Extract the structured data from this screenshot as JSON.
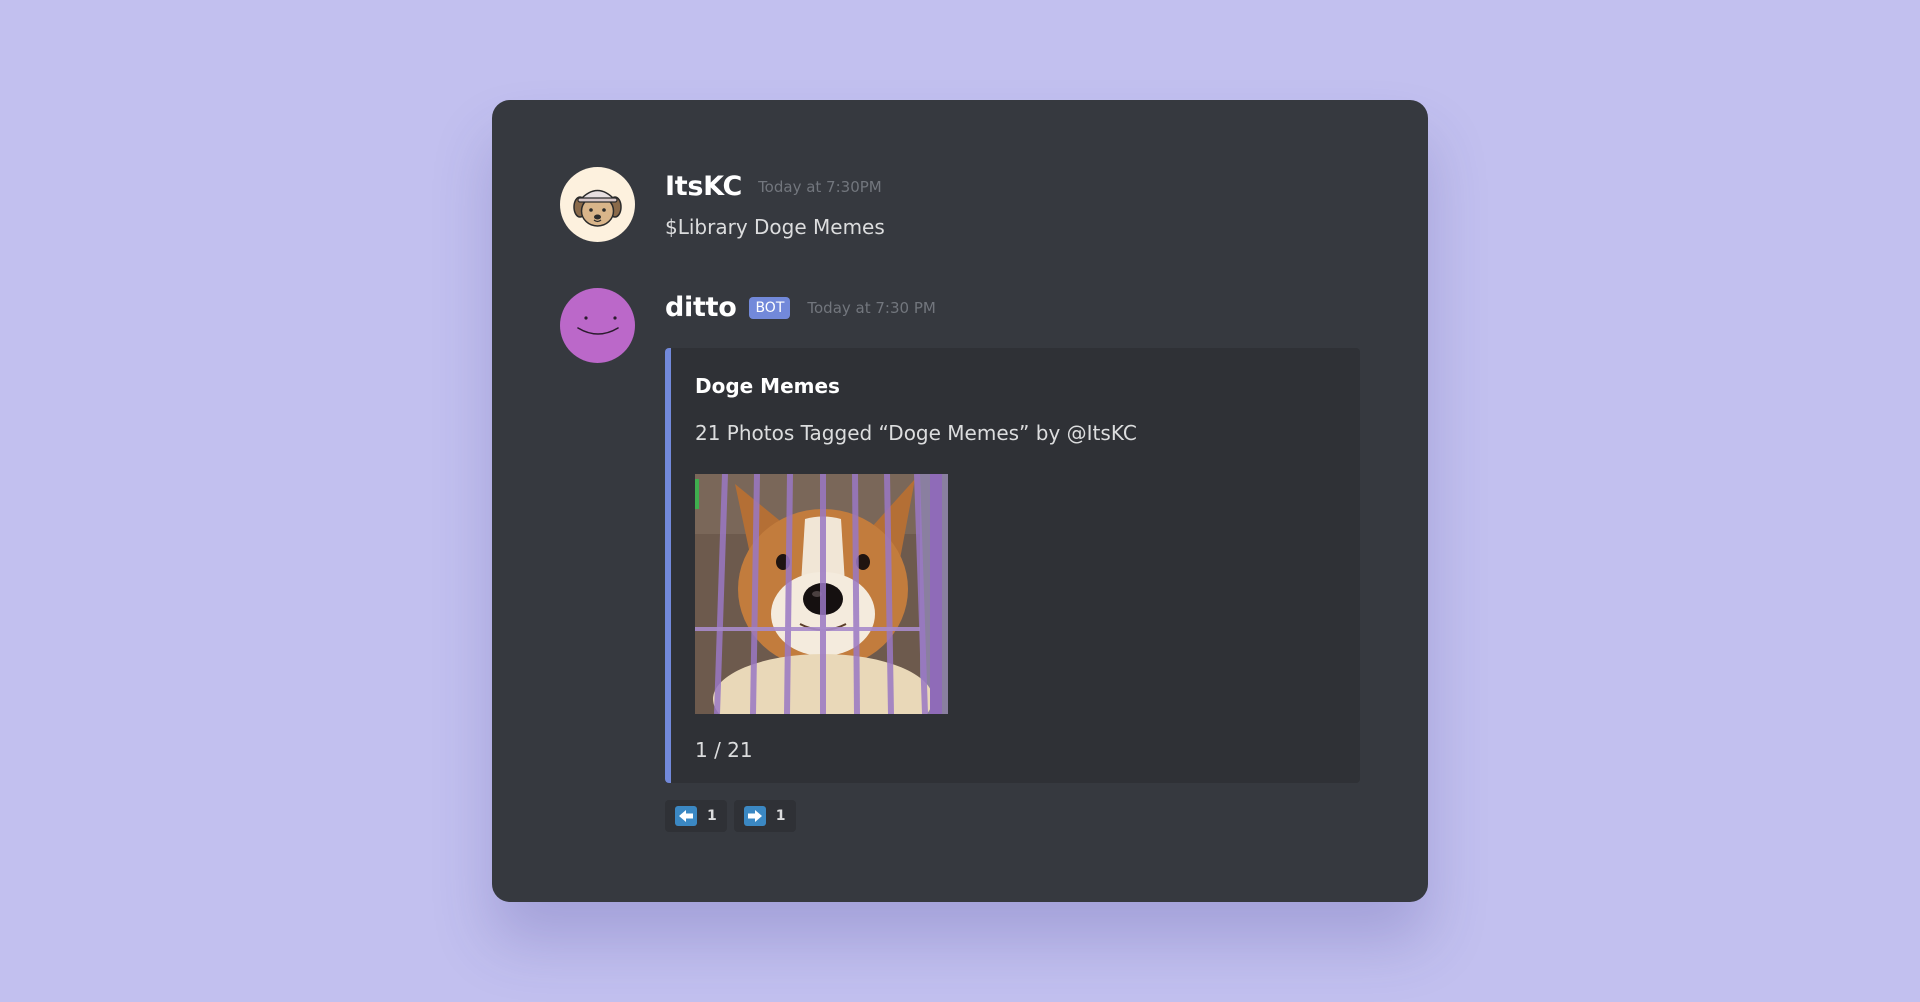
{
  "messages": [
    {
      "username": "ItsKC",
      "timestamp": "Today at 7:30PM",
      "content": "$Library Doge Memes",
      "avatar_icon": "dog-with-cap-avatar"
    },
    {
      "username": "ditto",
      "tag": "BOT",
      "timestamp": "Today at 7:30 PM",
      "avatar_icon": "ditto-face-avatar",
      "embed": {
        "accent_color": "#7289da",
        "title": "Doge Memes",
        "description": "21 Photos Tagged “Doge Memes” by @ItsKC",
        "image_icon": "corgi-in-cage-image",
        "footer": "1 / 21"
      },
      "reactions": [
        {
          "emoji": "left-arrow-icon",
          "count": "1"
        },
        {
          "emoji": "right-arrow-icon",
          "count": "1"
        }
      ]
    }
  ],
  "colors": {
    "background": "#c2c0ef",
    "card": "#36393f",
    "embed": "#2f3136",
    "bot_tag": "#7289da",
    "ditto_avatar": "#bb68c9"
  }
}
